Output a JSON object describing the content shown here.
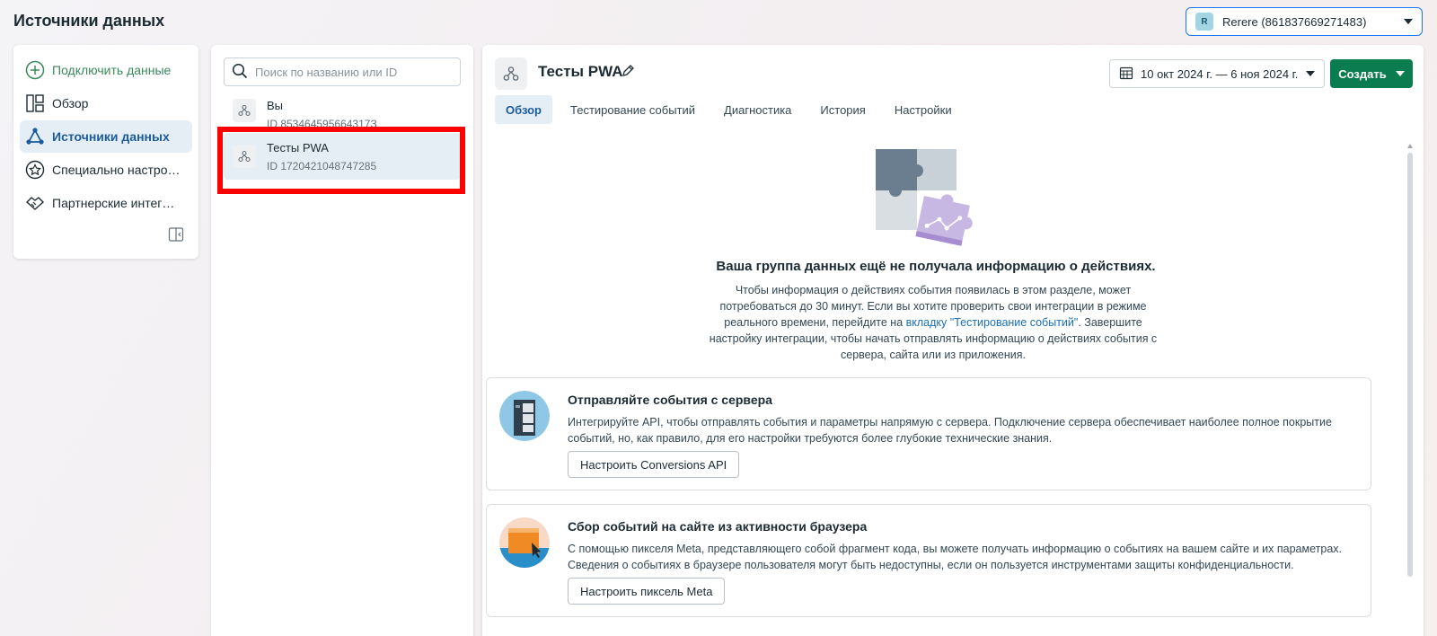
{
  "header": {
    "title": "Источники данных"
  },
  "account": {
    "initial": "R",
    "name": "Rerere (861837669271483)"
  },
  "sidebar": {
    "items": [
      {
        "label": "Подключить данные",
        "icon": "plus-circle-icon"
      },
      {
        "label": "Обзор",
        "icon": "layout-icon"
      },
      {
        "label": "Источники данных",
        "icon": "network-icon"
      },
      {
        "label": "Специально настро…",
        "icon": "star-badge-icon"
      },
      {
        "label": "Партнерские интег…",
        "icon": "handshake-icon"
      }
    ]
  },
  "search": {
    "placeholder": "Поиск по названию или ID"
  },
  "sources": [
    {
      "name": "Вы",
      "id": "ID 853464595664317З"
    },
    {
      "name": "Тесты PWA",
      "id": "ID 1720421048747285"
    }
  ],
  "main": {
    "title": "Тесты PWA",
    "date_range": "10 окт 2024 г. — 6 ноя 2024 г.",
    "create_label": "Создать",
    "tabs": [
      "Обзор",
      "Тестирование событий",
      "Диагностика",
      "История",
      "Настройки"
    ],
    "empty_title": "Ваша группа данных ещё не получала информацию о действиях.",
    "empty_desc_part1": "Чтобы информация о действиях события появилась в этом разделе, может потребоваться до 30 минут. Если вы хотите проверить свои интеграции в режиме реального времени, перейдите на ",
    "empty_desc_link": "вкладку \"Тестирование событий\"",
    "empty_desc_part2": ". Завершите настройку интеграции, чтобы начать отправлять информацию о действиях события с сервера, сайта или из приложения.",
    "cards": [
      {
        "title": "Отправляйте события с сервера",
        "text": "Интегрируйте API, чтобы отправлять события и параметры напрямую с сервера. Подключение сервера обеспечивает наиболее полное покрытие событий, но, как правило, для его настройки требуются более глубокие технические знания.",
        "button": "Настроить Conversions API"
      },
      {
        "title": "Сбор событий на сайте из активности браузера",
        "text": "С помощью пикселя Meta, представляющего собой фрагмент кода, вы можете получать информацию о событиях на вашем сайте и их параметрах. Сведения о событиях в браузере пользователя могут быть недоступны, если он пользуется инструментами защиты конфиденциальности.",
        "button": "Настроить пиксель Meta"
      }
    ]
  }
}
